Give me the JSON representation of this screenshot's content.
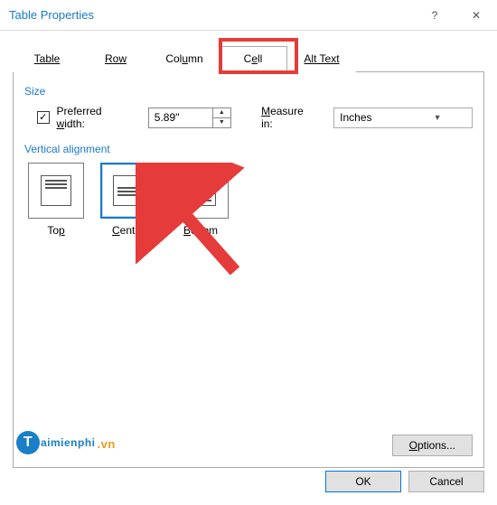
{
  "window": {
    "title": "Table Properties",
    "help_glyph": "?",
    "close_glyph": "✕"
  },
  "tabs": {
    "table": "Table",
    "row": "Row",
    "column": "Column",
    "cell": "Cell",
    "alttext": "Alt Text",
    "active": "cell"
  },
  "size": {
    "section": "Size",
    "pref_label_pre": "Preferred ",
    "pref_label_u": "w",
    "pref_label_post": "idth:",
    "pref_value": "5.89\"",
    "measure_pre": "",
    "measure_u": "M",
    "measure_post": "easure in:",
    "unit": "Inches"
  },
  "valign": {
    "section": "Vertical alignment",
    "top_pre": "To",
    "top_u": "p",
    "center_u": "C",
    "center_post": "enter",
    "bottom_u": "B",
    "bottom_post": "ottom",
    "selected": "center"
  },
  "buttons": {
    "options_u": "O",
    "options_post": "ptions...",
    "ok": "OK",
    "cancel": "Cancel"
  },
  "watermark": {
    "circ": "T",
    "text": "aimienphi",
    "suffix": ".vn"
  }
}
